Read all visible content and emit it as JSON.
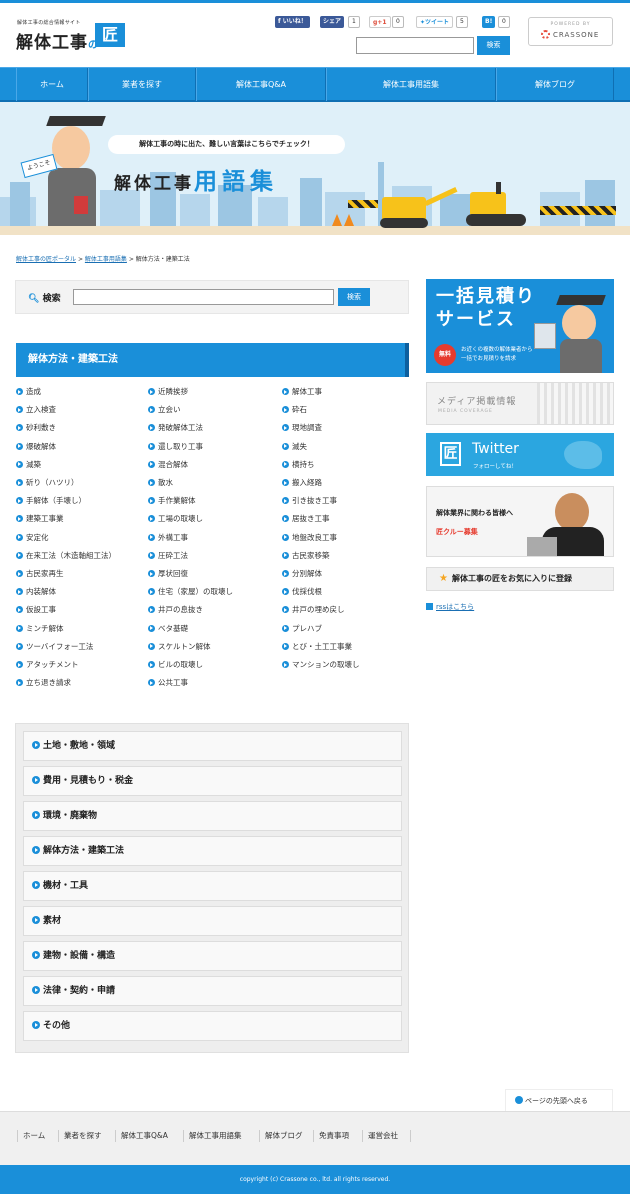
{
  "header": {
    "tagline": "解体工事の総合情報サイト",
    "logo_text": "解体工事",
    "logo_no": "の",
    "logo_mark": "匠",
    "social": {
      "fb_label": "いいね！",
      "share_label": "シェア",
      "share_count": "1",
      "gplus_label": "g+1",
      "gplus_count": "0",
      "tweet_label": "ツイート",
      "tweet_count": "5",
      "hatena_label": "B!",
      "hatena_count": "0"
    },
    "search_value": "",
    "search_button": "検索",
    "powered_by": "POWERED BY",
    "powered_brand": "CRASSONE"
  },
  "nav": [
    {
      "label": "ホーム"
    },
    {
      "label": "業者を探す"
    },
    {
      "label": "解体工事Q&A"
    },
    {
      "label": "解体工事用語集"
    },
    {
      "label": "解体ブログ"
    }
  ],
  "hero": {
    "subtitle": "解体工事の時に出た、難しい言葉はこちらでチェック！",
    "title": "解体工事",
    "title_accent": "用語集",
    "mascot_sign": "ようこそ"
  },
  "breadcrumb": {
    "home": "解体工事の匠ポータル",
    "parent": "解体工事用語集",
    "current": "解体方法・建築工法",
    "sep": ">"
  },
  "search": {
    "label": "検索",
    "value": "",
    "button": "検索"
  },
  "category_heading": "解体方法・建築工法",
  "terms": [
    [
      "造成",
      "近隣挨拶",
      "解体工事"
    ],
    [
      "立入検査",
      "立会い",
      "砕石"
    ],
    [
      "砂利敷き",
      "発破解体工法",
      "現地調査"
    ],
    [
      "爆破解体",
      "還し取り工事",
      "滅失"
    ],
    [
      "減築",
      "混合解体",
      "横持ち"
    ],
    [
      "斫り（ハツリ）",
      "散水",
      "搬入経路"
    ],
    [
      "手解体（手壊し）",
      "手作業解体",
      "引き抜き工事"
    ],
    [
      "建築工事業",
      "工場の取壊し",
      "居抜き工事"
    ],
    [
      "安定化",
      "外構工事",
      "地盤改良工事"
    ],
    [
      "在来工法（木造軸組工法）",
      "圧砕工法",
      "古民家移築"
    ],
    [
      "古民家再生",
      "厚状回復",
      "分別解体"
    ],
    [
      "内装解体",
      "住宅（家屋）の取壊し",
      "伐採伐根"
    ],
    [
      "仮設工事",
      "井戸の息抜き",
      "井戸の埋め戻し"
    ],
    [
      "ミンチ解体",
      "ベタ基礎",
      "プレハブ"
    ],
    [
      "ツーバイフォー工法",
      "スケルトン解体",
      "とび・土工工事業"
    ],
    [
      "アタッチメント",
      "ビルの取壊し",
      "マンションの取壊し"
    ],
    [
      "立ち退き請求",
      "公共工事",
      ""
    ]
  ],
  "categories": [
    "土地・敷地・領域",
    "費用・見積もり・税金",
    "環境・廃棄物",
    "解体方法・建築工法",
    "機材・工具",
    "素材",
    "建物・設備・構造",
    "法律・契約・申請",
    "その他"
  ],
  "sidebar": {
    "estimate_title_1": "一括見積り",
    "estimate_title_2": "サービス",
    "estimate_free": "無料",
    "estimate_desc_1": "お近くの複数の解体業者から",
    "estimate_desc_2": "一括でお見積りを請求",
    "media_title": "メディア掲載情報",
    "media_sub": "MEDIA COVERAGE",
    "twitter_title": "Twitter",
    "twitter_sub": "フォローしてね！",
    "crew_title": "解体業界に関わる皆様へ",
    "crew_sub": "匠クルー募集",
    "fav_label": "解体工事の匠をお気に入りに登録",
    "rss_label": "rssはこちら"
  },
  "footer": {
    "to_top": "ページの先頭へ戻る",
    "links": [
      "ホーム",
      "業者を探す",
      "解体工事Q&A",
      "解体工事用語集",
      "解体ブログ",
      "免責事項",
      "運営会社"
    ],
    "copyright": "copyright (c) Crassone co., ltd. all rights reserved."
  },
  "colors": {
    "accent": "#1a8fd9",
    "accent_dark": "#0f6fb3",
    "badge_red": "#e63b2e",
    "star": "#f5a623"
  }
}
